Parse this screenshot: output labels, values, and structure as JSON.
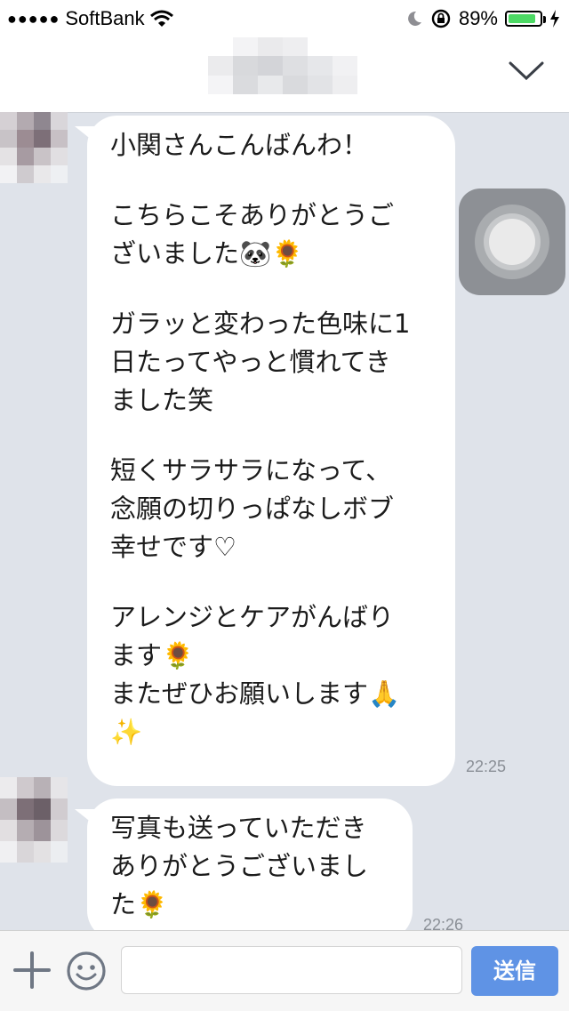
{
  "status_bar": {
    "carrier": "SoftBank",
    "battery_percent": "89%",
    "battery_level": 0.89
  },
  "messages": [
    {
      "paragraphs": [
        "小関さんこんばんわ！",
        "こちらこそありがとうご\nざいました🐼🌻",
        "ガラッと変わった色味に1\n日たってやっと慣れてき\nました笑",
        "短くサラサラになって、\n念願の切りっぱなしボブ\n幸せです♡",
        "アレンジとケアがんばり\nます🌻\nまたぜひお願いします🙏\n✨"
      ],
      "time": "22:25"
    },
    {
      "paragraphs": [
        "写真も送っていただき\nありがとうございまし\nた🌻"
      ],
      "time": "22:26"
    }
  ],
  "input": {
    "placeholder": "",
    "send_label": "送信"
  },
  "icons": {
    "signal": "signal-dots-icon",
    "wifi": "wifi-icon",
    "moon": "do-not-disturb-icon",
    "lock": "rotation-lock-icon",
    "battery": "battery-icon",
    "charging": "charging-bolt-icon",
    "collapse": "chevron-down-icon",
    "plus": "plus-icon",
    "emoji": "smiley-icon"
  },
  "colors": {
    "chat_background": "#dfe3ea",
    "send_button": "#5f93e5",
    "battery_fill": "#4cd964"
  }
}
